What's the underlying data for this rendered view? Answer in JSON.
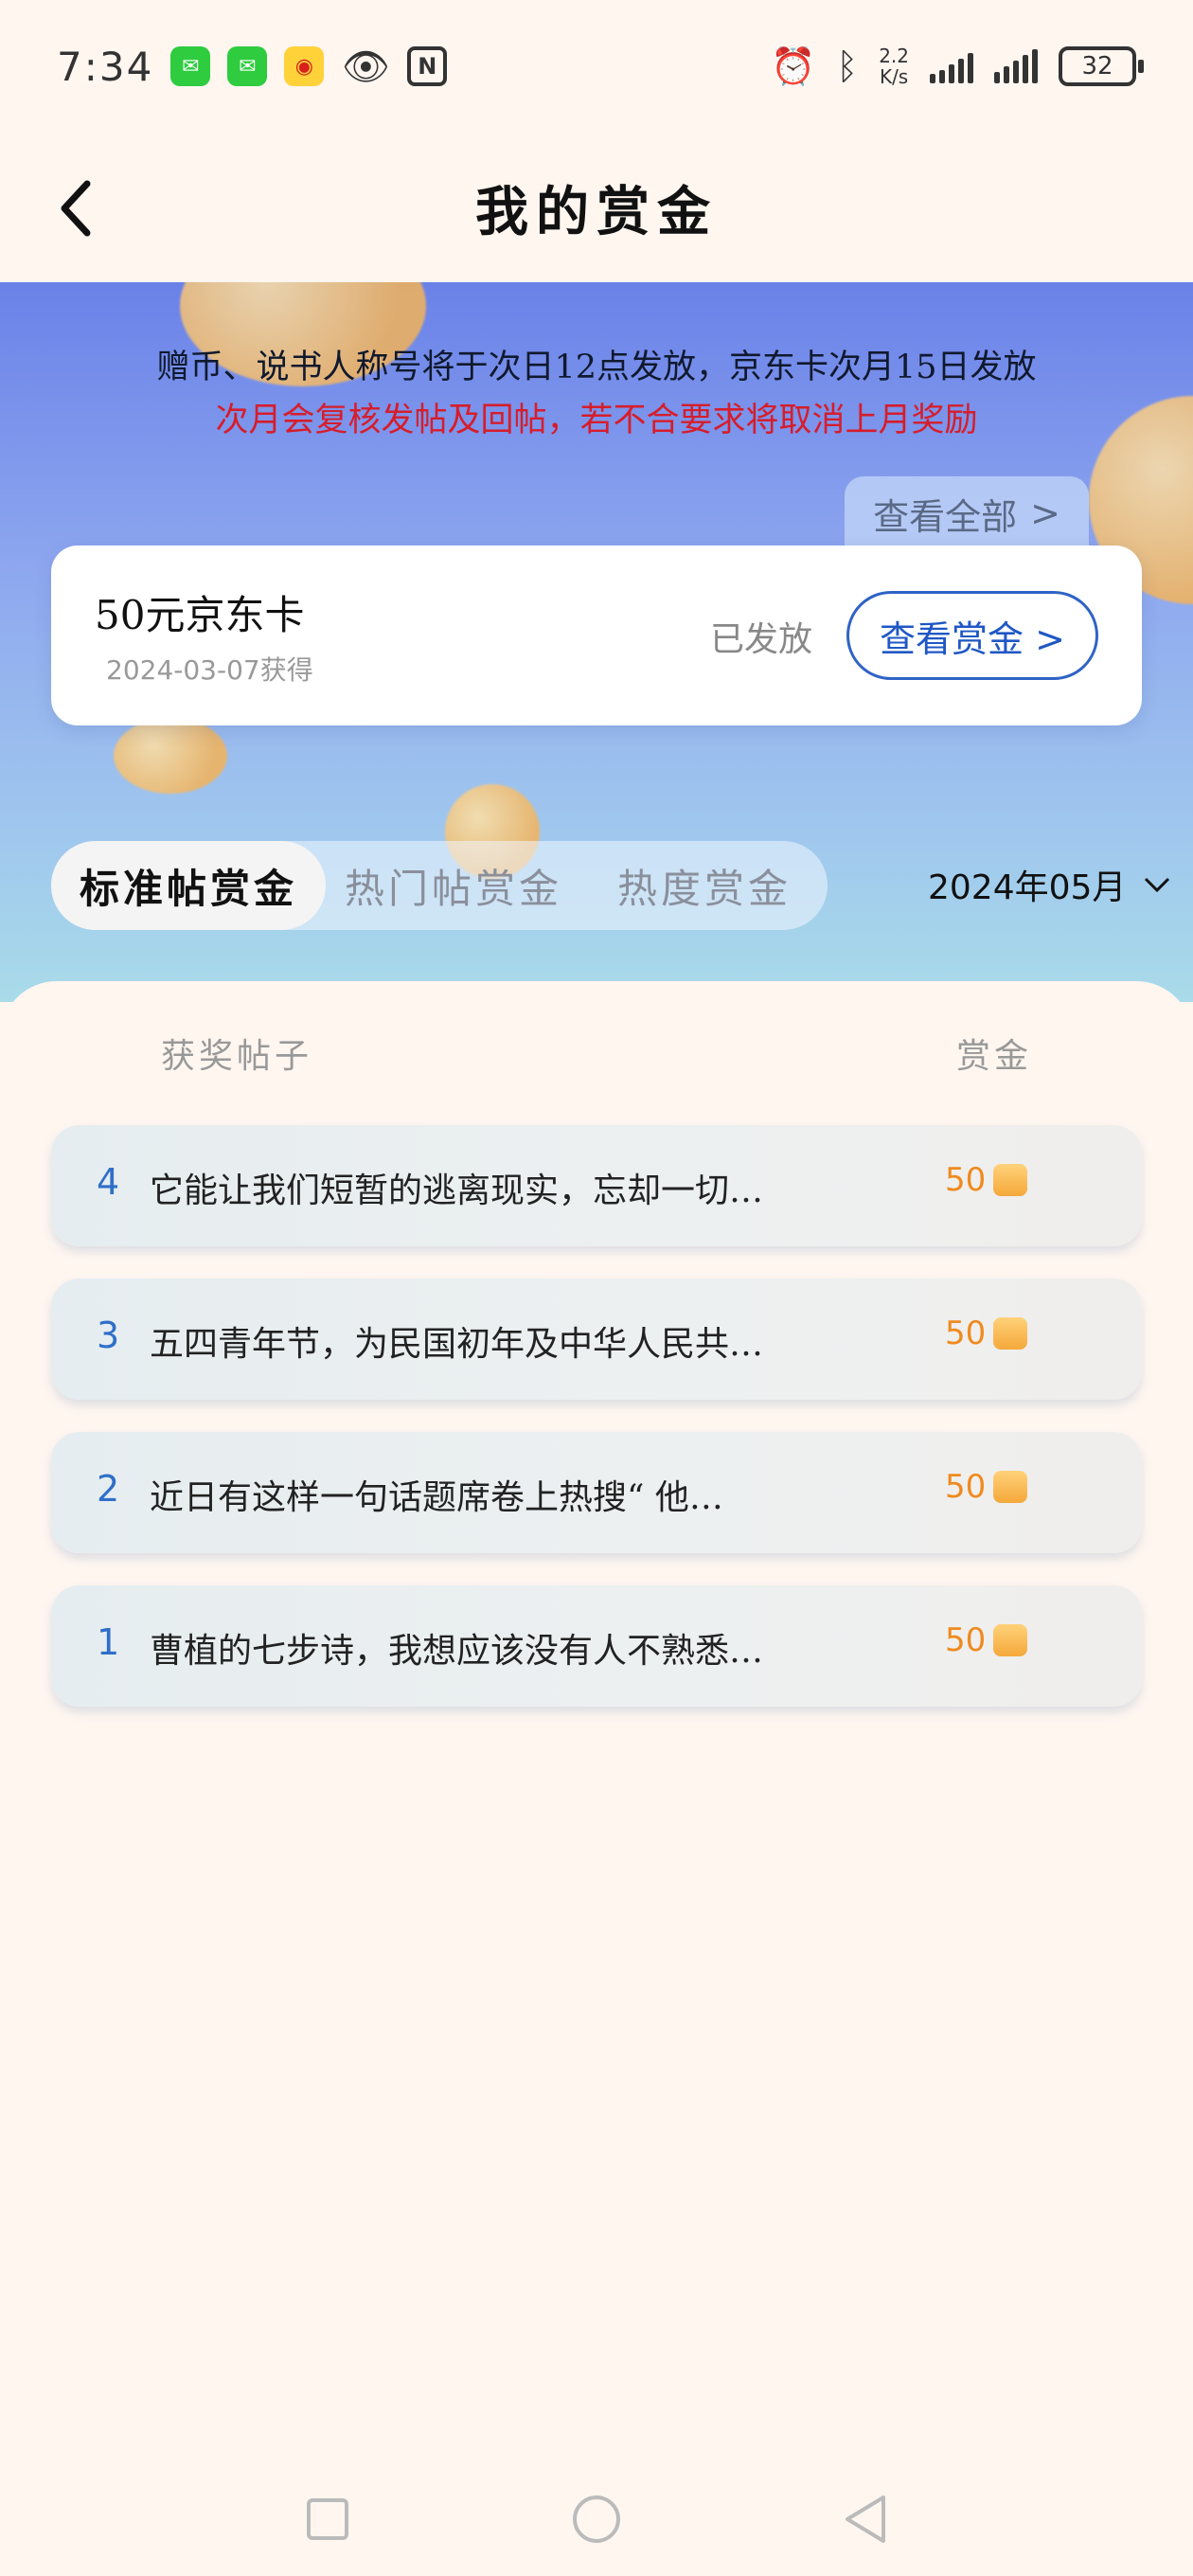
{
  "status_bar": {
    "time": "7:34",
    "net_speed_value": "2.2",
    "net_speed_unit": "K/s",
    "battery": "32",
    "icons": [
      "wechat-icon",
      "wechat-icon",
      "weibo-icon",
      "eye-icon",
      "nfc-icon",
      "alarm-icon",
      "bluetooth-icon",
      "signal-icon",
      "signal-icon",
      "battery-icon"
    ]
  },
  "header": {
    "title": "我的赏金"
  },
  "notice": {
    "line1": "赠币、说书人称号将于次日12点发放，京东卡次月15日发放",
    "line2": "次月会复核发帖及回帖，若不合要求将取消上月奖励"
  },
  "view_all": {
    "label": "查看全部",
    "arrow": ">"
  },
  "reward_card": {
    "name": "50元京东卡",
    "date": "2024-03-07获得",
    "status": "已发放",
    "button_label": "查看赏金 >"
  },
  "tabs": [
    {
      "label": "标准帖赏金",
      "active": true
    },
    {
      "label": "热门帖赏金",
      "active": false
    },
    {
      "label": "热度赏金",
      "active": false
    }
  ],
  "month_select": {
    "value": "2024年05月"
  },
  "list": {
    "header_post": "获奖帖子",
    "header_amount": "赏金",
    "rows": [
      {
        "rank": "4",
        "title": "它能让我们短暂的逃离现实，忘却一切…",
        "amount": "50"
      },
      {
        "rank": "3",
        "title": "五四青年节，为民国初年及中华人民共…",
        "amount": "50"
      },
      {
        "rank": "2",
        "title": "近日有这样一句话题席卷上热搜“ 他…",
        "amount": "50"
      },
      {
        "rank": "1",
        "title": "曹植的七步诗，我想应该没有人不熟悉…",
        "amount": "50"
      }
    ]
  },
  "colors": {
    "accent_blue": "#1f57c4",
    "notice_red": "#d61d2b",
    "amount_orange": "#ef8a1f"
  }
}
